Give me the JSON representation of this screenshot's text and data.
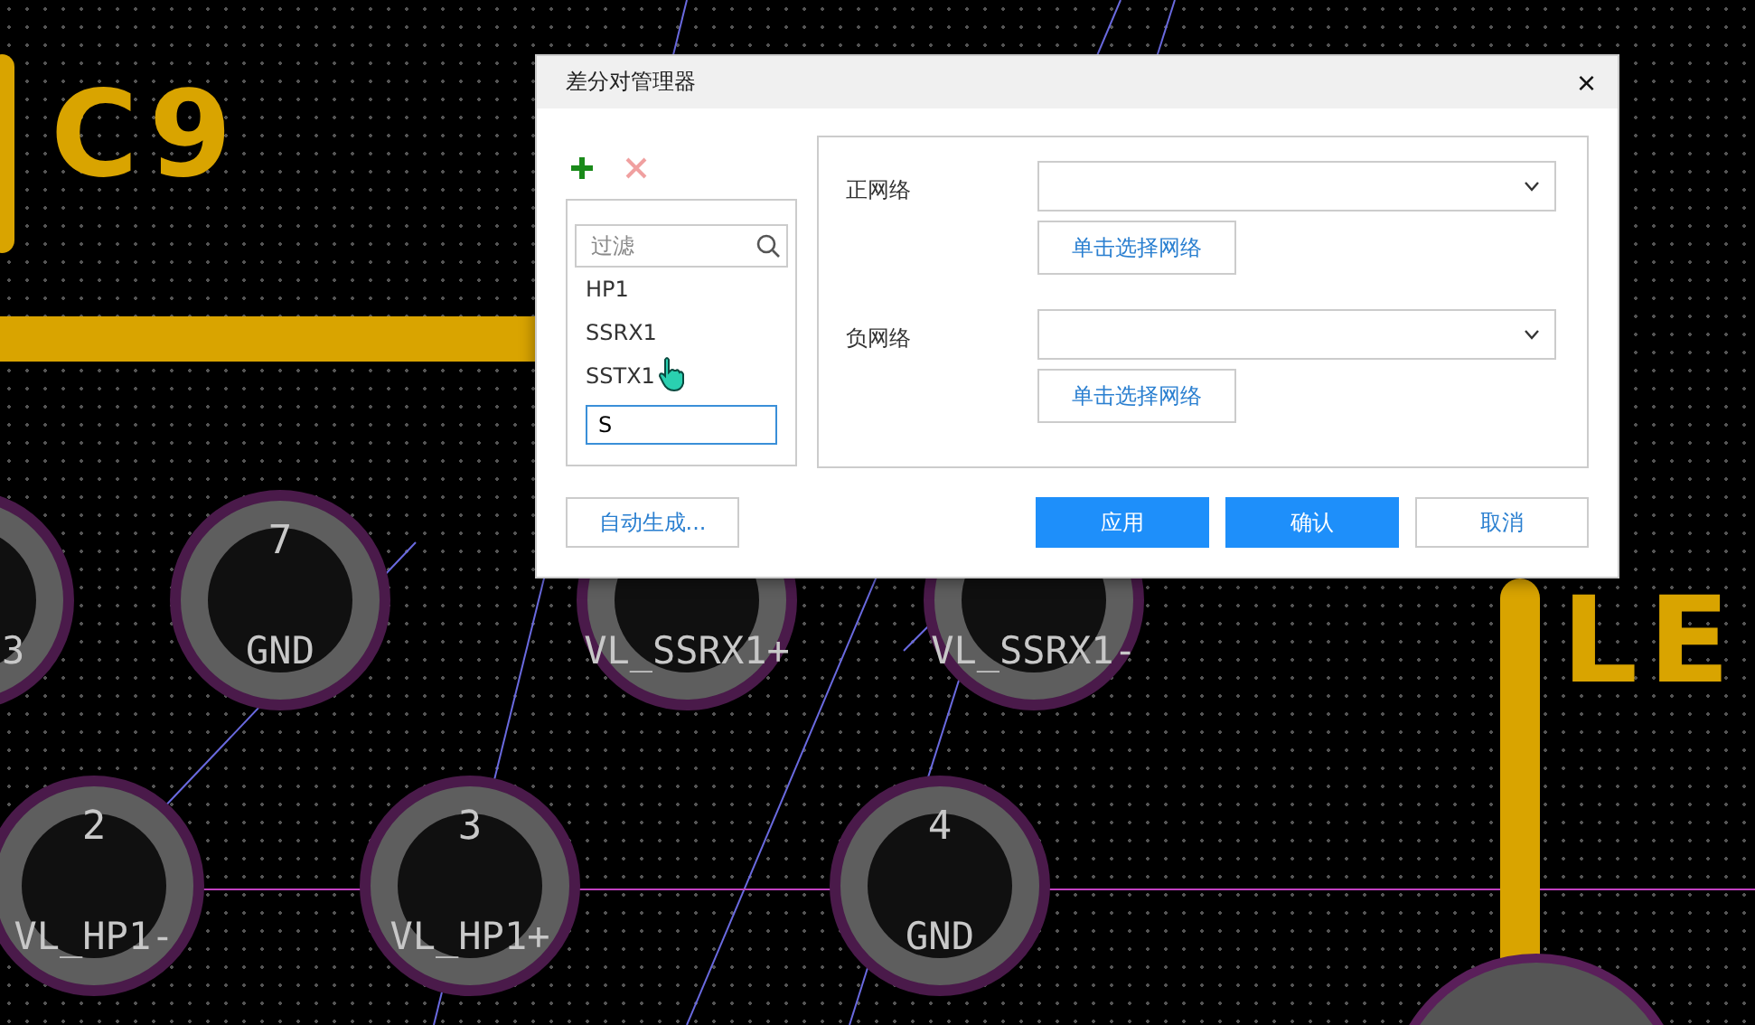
{
  "canvas": {
    "silkscreen": [
      "C9",
      "LE"
    ],
    "pads": [
      {
        "net": "3"
      },
      {
        "number": "7",
        "net": "GND"
      },
      {
        "net": "VL_SSRX1+"
      },
      {
        "net": "VL_SSRX1-"
      },
      {
        "number": "2",
        "net": "VL_HP1-"
      },
      {
        "number": "3",
        "net": "VL_HP1+"
      },
      {
        "number": "4",
        "net": "GND"
      }
    ]
  },
  "dialog": {
    "title": "差分对管理器",
    "close": "×",
    "pair_list": {
      "filter_placeholder": "过滤",
      "items": [
        "HP1",
        "SSRX1",
        "SSTX1"
      ],
      "new_item_value": "S"
    },
    "fields": [
      {
        "label": "正网络",
        "button": "单击选择网络"
      },
      {
        "label": "负网络",
        "button": "单击选择网络"
      }
    ],
    "auto_button": "自动生成...",
    "buttons": [
      {
        "label": "应用",
        "kind": "primary"
      },
      {
        "label": "确认",
        "kind": "primary"
      },
      {
        "label": "取消",
        "kind": "plain"
      }
    ]
  }
}
